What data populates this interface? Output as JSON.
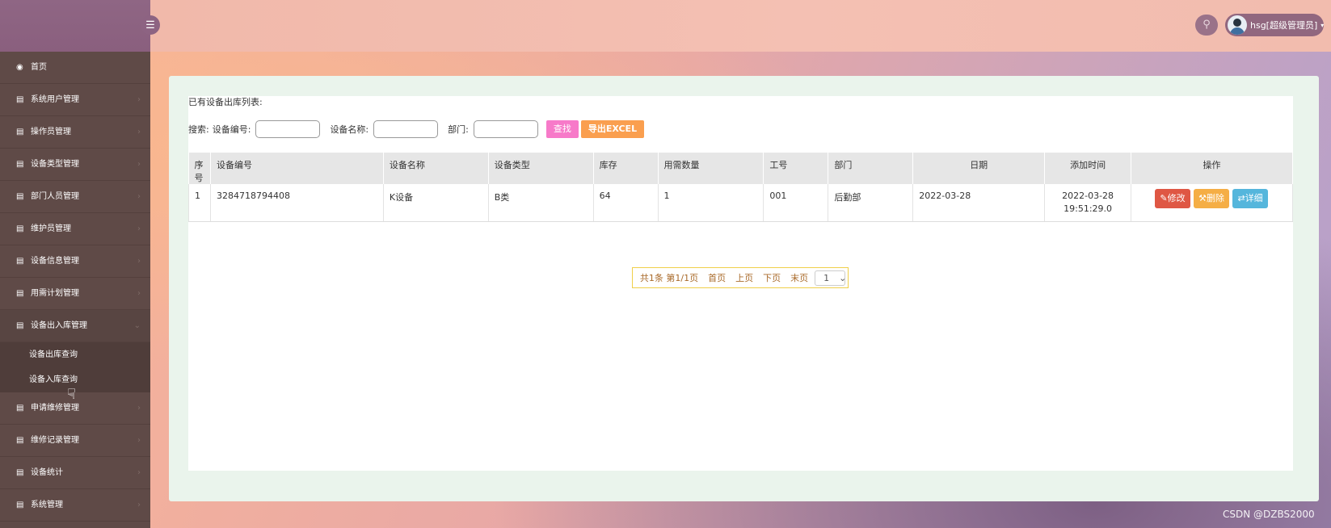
{
  "sidebar": {
    "items": [
      {
        "label": "首页",
        "icon": "dashboard-icon"
      },
      {
        "label": "系统用户管理",
        "icon": "list-icon"
      },
      {
        "label": "操作员管理",
        "icon": "list-icon"
      },
      {
        "label": "设备类型管理",
        "icon": "list-icon"
      },
      {
        "label": "部门人员管理",
        "icon": "list-icon"
      },
      {
        "label": "维护员管理",
        "icon": "list-icon"
      },
      {
        "label": "设备信息管理",
        "icon": "list-icon"
      },
      {
        "label": "用需计划管理",
        "icon": "list-icon"
      },
      {
        "label": "设备出入库管理",
        "icon": "list-icon"
      },
      {
        "label": "申请维修管理",
        "icon": "list-icon"
      },
      {
        "label": "维修记录管理",
        "icon": "list-icon"
      },
      {
        "label": "设备统计",
        "icon": "list-icon"
      },
      {
        "label": "系统管理",
        "icon": "list-icon"
      }
    ],
    "subitems": [
      {
        "label": "设备出库查询"
      },
      {
        "label": "设备入库查询"
      }
    ]
  },
  "header": {
    "user": "hsg[超级管理员]"
  },
  "main": {
    "list_title": "已有设备出库列表:",
    "search": {
      "label_prefix": "搜索:",
      "code_label": "设备编号:",
      "name_label": "设备名称:",
      "dept_label": "部门:",
      "code_value": "",
      "name_value": "",
      "dept_value": "",
      "find_button": "查找",
      "export_button": "导出EXCEL"
    },
    "table": {
      "headers": [
        "序号",
        "设备编号",
        "设备名称",
        "设备类型",
        "库存",
        "用需数量",
        "工号",
        "部门",
        "日期",
        "添加时间",
        "操作"
      ],
      "rows": [
        {
          "index": "1",
          "code": "3284718794408",
          "name": "K设备",
          "type": "B类",
          "stock": "64",
          "qty": "1",
          "worker_no": "001",
          "dept": "后勤部",
          "date": "2022-03-28",
          "added_date": "2022-03-28",
          "added_time": "19:51:29.0",
          "edit": "修改",
          "delete": "删除",
          "detail": "详细"
        }
      ]
    },
    "pager": {
      "summary": "共1条 第1/1页",
      "first": "首页",
      "prev": "上页",
      "next": "下页",
      "last": "末页",
      "page_select": "1"
    }
  },
  "watermark": "CSDN @DZBS2000"
}
